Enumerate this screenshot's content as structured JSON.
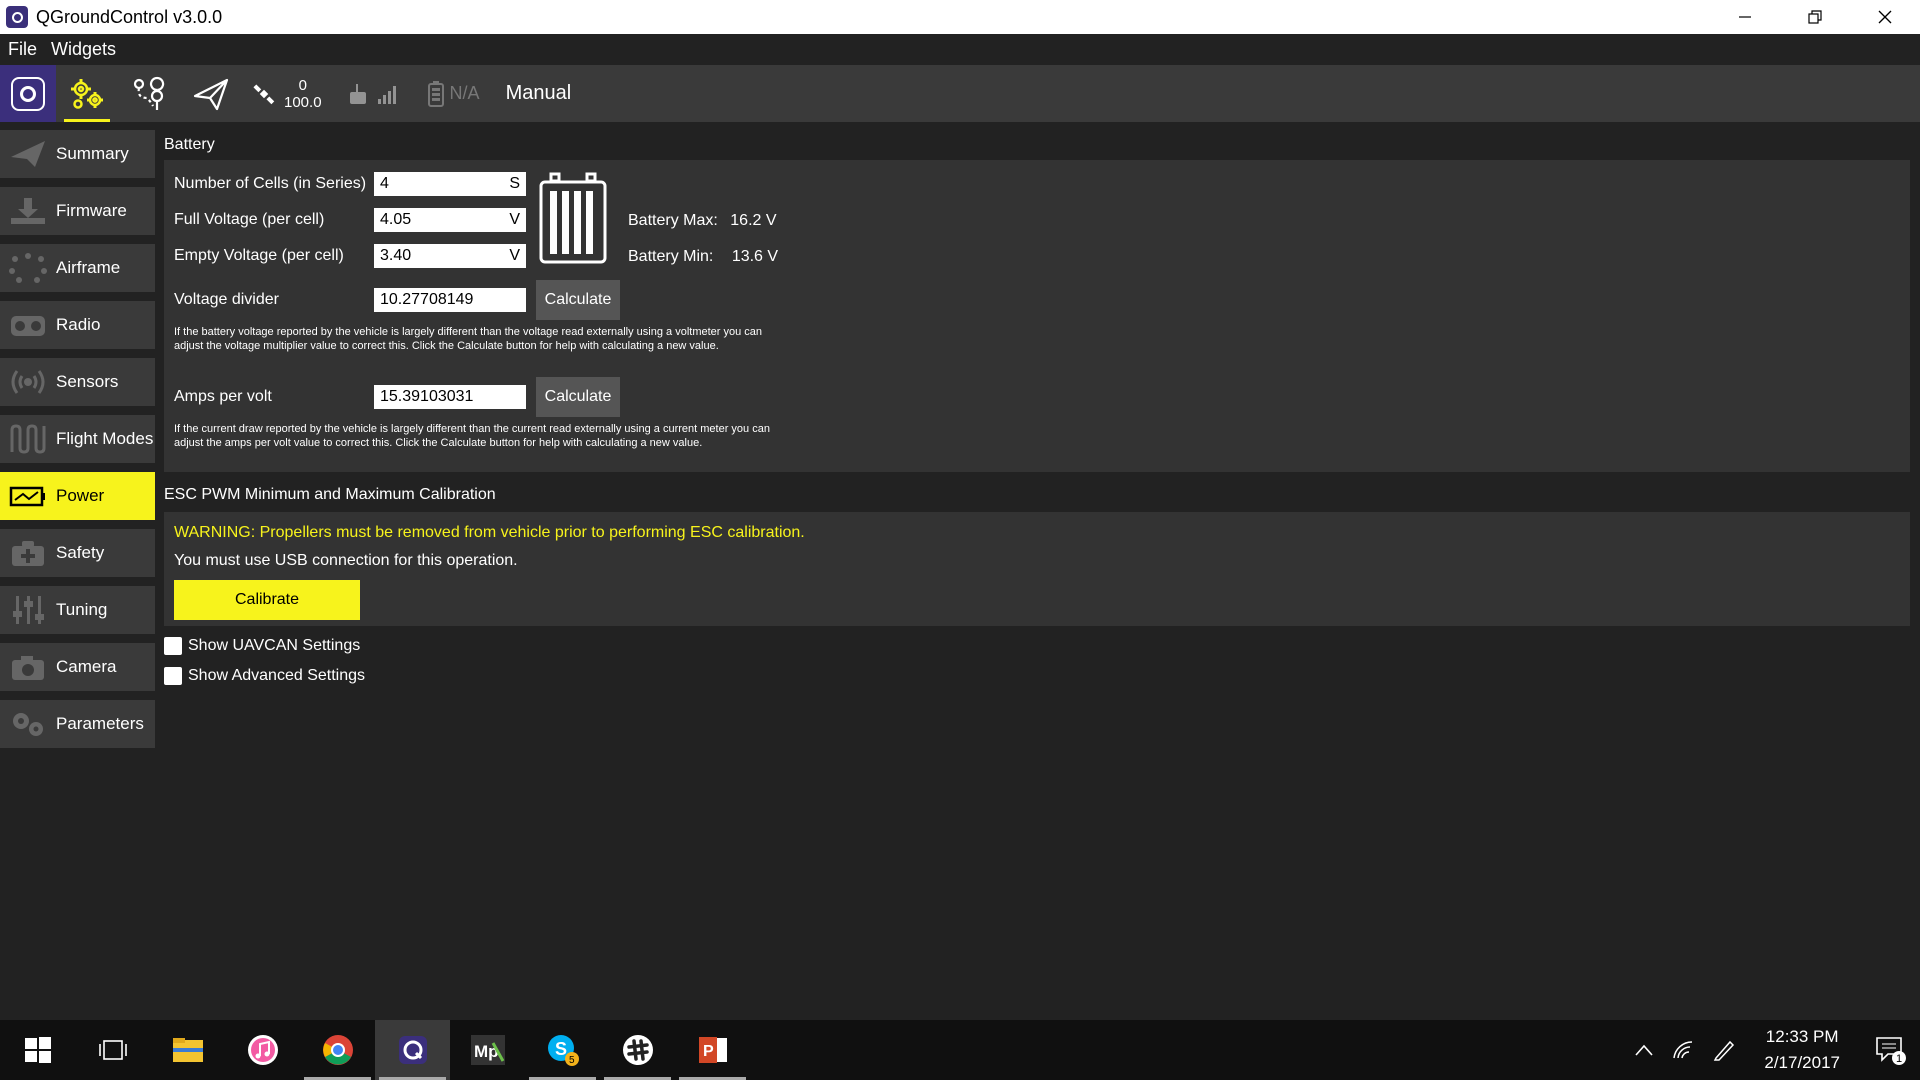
{
  "window": {
    "title": "QGroundControl v3.0.0"
  },
  "menu": {
    "items": [
      "File",
      "Widgets"
    ]
  },
  "toolbar": {
    "gps_count": "0",
    "gps_hdop": "100.0",
    "battery_text": "N/A",
    "flight_mode": "Manual",
    "icons": [
      "qgc-logo-icon",
      "settings-gear-icon",
      "plan-view-icon",
      "fly-view-icon",
      "gps-satellite-icon",
      "rc-signal-icon",
      "battery-icon"
    ]
  },
  "sidebar": {
    "items": [
      {
        "label": "Summary",
        "icon": "paper-plane-icon"
      },
      {
        "label": "Firmware",
        "icon": "download-icon"
      },
      {
        "label": "Airframe",
        "icon": "airframe-icon"
      },
      {
        "label": "Radio",
        "icon": "radio-icon"
      },
      {
        "label": "Sensors",
        "icon": "sensors-icon"
      },
      {
        "label": "Flight Modes",
        "icon": "flight-modes-icon"
      },
      {
        "label": "Power",
        "icon": "power-icon",
        "active": true
      },
      {
        "label": "Safety",
        "icon": "safety-icon"
      },
      {
        "label": "Tuning",
        "icon": "tuning-icon"
      },
      {
        "label": "Camera",
        "icon": "camera-icon"
      },
      {
        "label": "Parameters",
        "icon": "parameters-icon"
      }
    ]
  },
  "battery": {
    "title": "Battery",
    "cells_label": "Number of Cells (in Series)",
    "cells_value": "4",
    "cells_unit": "S",
    "full_label": "Full Voltage (per cell)",
    "full_value": "4.05",
    "full_unit": "V",
    "empty_label": "Empty Voltage (per cell)",
    "empty_value": "3.40",
    "empty_unit": "V",
    "max_label": "Battery Max:",
    "max_value": "16.2 V",
    "min_label": "Battery Min:",
    "min_value": "13.6 V",
    "divider_label": "Voltage divider",
    "divider_value": "10.27708149",
    "calculate_label": "Calculate",
    "divider_help": "If the battery voltage reported by the vehicle is largely different than the voltage read externally using a voltmeter you can adjust the voltage multiplier value to correct this. Click the Calculate button for help with calculating a new value.",
    "amps_label": "Amps per volt",
    "amps_value": "15.39103031",
    "amps_help": "If the current draw reported by the vehicle is largely different than the current read externally using a current meter you can adjust the amps per volt value to correct this. Click the Calculate button for help with calculating a new value."
  },
  "esc": {
    "title": "ESC PWM Minimum and Maximum Calibration",
    "warning": "WARNING: Propellers must be removed from vehicle prior to performing ESC calibration.",
    "usb_note": "You must use USB connection for this operation.",
    "calibrate_label": "Calibrate"
  },
  "options": {
    "show_uavcan": "Show UAVCAN Settings",
    "show_advanced": "Show Advanced Settings"
  },
  "taskbar": {
    "time": "12:33 PM",
    "date": "2/17/2017",
    "notification_count": "1",
    "skype_badge": "5"
  },
  "colors": {
    "accent": "#f7f31c",
    "panel": "#333333",
    "background": "#222222",
    "toolbar": "#3a3a3a"
  }
}
